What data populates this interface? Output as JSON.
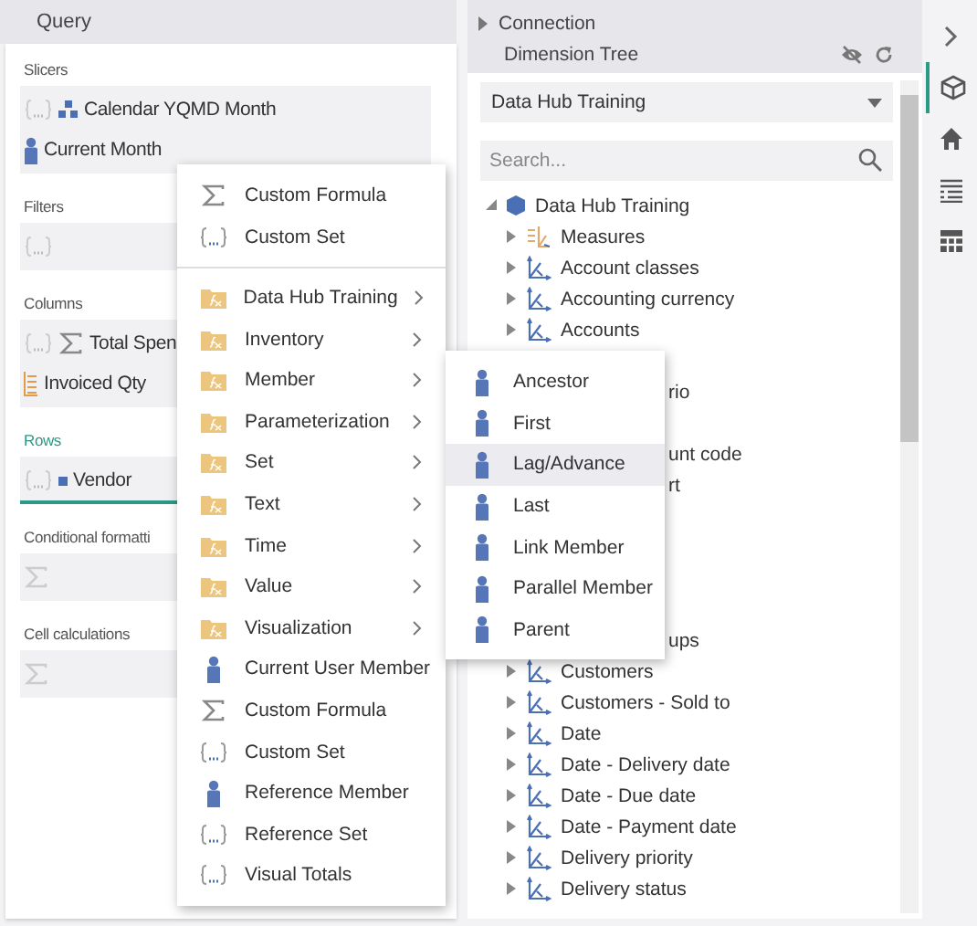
{
  "query_panel": {
    "title": "Query",
    "sections": [
      {
        "label": "Slicers",
        "kind": "set",
        "active": false,
        "items": [
          {
            "kind": "hierarchy",
            "label": "Calendar YQMD Month"
          },
          {
            "kind": "member",
            "label": "Current Month"
          }
        ]
      },
      {
        "label": "Filters",
        "kind": "set",
        "active": false
      },
      {
        "label": "Columns",
        "kind": "set",
        "active": false,
        "items": [
          {
            "kind": "formula",
            "label": "Total Spen"
          },
          {
            "kind": "measure",
            "label": "Invoiced Qty"
          }
        ]
      },
      {
        "label": "Rows",
        "kind": "set",
        "active": true,
        "items": [
          {
            "kind": "level",
            "label": "Vendor"
          }
        ]
      },
      {
        "label": "Conditional formatti",
        "kind": "calc",
        "active": false
      },
      {
        "label": "Cell calculations",
        "kind": "calc",
        "active": false
      }
    ]
  },
  "dimension_panel": {
    "connection": "Connection",
    "title": "Dimension Tree",
    "cube_select": "Data Hub Training",
    "search": {
      "placeholder": "Search..."
    },
    "tree": {
      "label": "Data Hub Training",
      "expanded": true,
      "children": [
        {
          "kind": "measures",
          "label": "Measures",
          "expanded": false
        },
        {
          "kind": "dimension",
          "label": "Account classes",
          "expanded": false
        },
        {
          "kind": "dimension",
          "label": "Accounting currency",
          "expanded": false
        },
        {
          "kind": "dimension",
          "label": "Accounts",
          "expanded": false
        },
        {
          "kind": "covered"
        },
        {
          "kind": "fragment",
          "label": "rio"
        },
        {
          "kind": "covered"
        },
        {
          "kind": "fragment",
          "label": "unt code"
        },
        {
          "kind": "fragment",
          "label": "rt"
        },
        {
          "kind": "covered"
        },
        {
          "kind": "covered"
        },
        {
          "kind": "covered"
        },
        {
          "kind": "covered"
        },
        {
          "kind": "fragment",
          "label": "ups"
        },
        {
          "kind": "dimension",
          "label": "Customers",
          "expanded": false
        },
        {
          "kind": "dimension",
          "label": "Customers - Sold to",
          "expanded": false
        },
        {
          "kind": "dimension",
          "label": "Date",
          "expanded": false
        },
        {
          "kind": "dimension",
          "label": "Date - Delivery date",
          "expanded": false
        },
        {
          "kind": "dimension",
          "label": "Date - Due date",
          "expanded": false
        },
        {
          "kind": "dimension",
          "label": "Date - Payment date",
          "expanded": false
        },
        {
          "kind": "dimension",
          "label": "Delivery priority",
          "expanded": false
        },
        {
          "kind": "dimension",
          "label": "Delivery status",
          "expanded": false
        }
      ]
    }
  },
  "side_bar": [
    {
      "kind": "collapse",
      "selected": false
    },
    {
      "kind": "cube",
      "selected": true
    },
    {
      "kind": "home",
      "selected": false
    },
    {
      "kind": "list",
      "selected": false
    },
    {
      "kind": "grid",
      "selected": false
    }
  ],
  "context_menu": [
    {
      "kind": "formula",
      "label": "Custom Formula"
    },
    {
      "kind": "set",
      "label": "Custom Set"
    },
    {
      "kind": "divider"
    },
    {
      "kind": "folder",
      "label": "Data Hub Training",
      "submenu": true
    },
    {
      "kind": "folder",
      "label": "Inventory",
      "submenu": true
    },
    {
      "kind": "folder",
      "label": "Member",
      "submenu": true
    },
    {
      "kind": "folder",
      "label": "Parameterization",
      "submenu": true
    },
    {
      "kind": "folder",
      "label": "Set",
      "submenu": true
    },
    {
      "kind": "folder",
      "label": "Text",
      "submenu": true
    },
    {
      "kind": "folder",
      "label": "Time",
      "submenu": true
    },
    {
      "kind": "folder",
      "label": "Value",
      "submenu": true
    },
    {
      "kind": "folder",
      "label": "Visualization",
      "submenu": true
    },
    {
      "kind": "member",
      "label": "Current User Member"
    },
    {
      "kind": "formula",
      "label": "Custom Formula"
    },
    {
      "kind": "set",
      "label": "Custom Set"
    },
    {
      "kind": "member",
      "label": "Reference Member"
    },
    {
      "kind": "set",
      "label": "Reference Set"
    },
    {
      "kind": "set",
      "label": "Visual Totals"
    }
  ],
  "submenu": [
    {
      "kind": "member",
      "label": "Ancestor",
      "selected": false
    },
    {
      "kind": "member",
      "label": "First",
      "selected": false
    },
    {
      "kind": "member",
      "label": "Lag/Advance",
      "selected": true
    },
    {
      "kind": "member",
      "label": "Last",
      "selected": false
    },
    {
      "kind": "member",
      "label": "Link Member",
      "selected": false
    },
    {
      "kind": "member",
      "label": "Parallel Member",
      "selected": false
    },
    {
      "kind": "member",
      "label": "Parent",
      "selected": false
    }
  ]
}
